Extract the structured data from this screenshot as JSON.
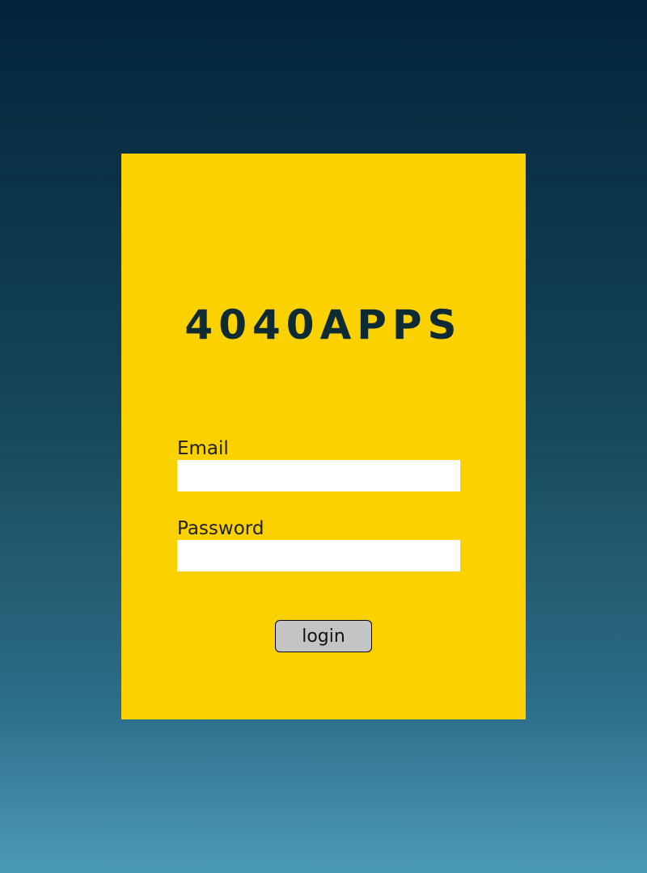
{
  "logo": {
    "text": "4040APPS"
  },
  "form": {
    "email": {
      "label": "Email",
      "value": "",
      "placeholder": ""
    },
    "password": {
      "label": "Password",
      "value": "",
      "placeholder": ""
    },
    "submit_label": "login"
  },
  "colors": {
    "card_background": "#fbd200",
    "logo_text": "#0e2a33",
    "button_background": "#c4c4c4",
    "page_gradient_top": "#02243a",
    "page_gradient_bottom": "#4b9ab8"
  }
}
